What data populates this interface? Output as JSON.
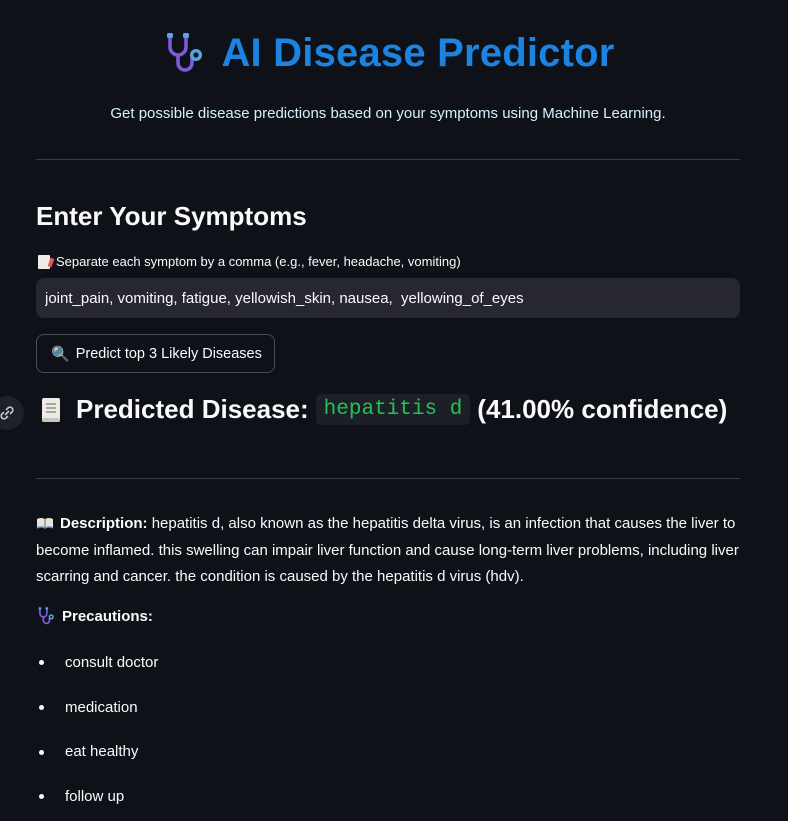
{
  "header": {
    "title": "AI Disease Predictor",
    "subtitle": "Get possible disease predictions based on your symptoms using Machine Learning.",
    "title_color": "#1c83e1",
    "title_icon": "stethoscope-icon"
  },
  "input_section": {
    "heading": "Enter Your Symptoms",
    "helper_icon": "memo-icon",
    "helper_text": "Separate each symptom by a comma (e.g., fever, headache, vomiting)",
    "symptoms_value": "joint_pain, vomiting, fatigue, yellowish_skin, nausea,  yellowing_of_eyes",
    "predict_button_icon": "magnifier-icon",
    "predict_button_label": "Predict top 3 Likely Diseases"
  },
  "result": {
    "icon": "scroll-icon",
    "label": "Predicted Disease:",
    "disease": "hepatitis d",
    "confidence": "(41.00% confidence)",
    "disease_color": "#21c354",
    "anchor_icon": "link-icon"
  },
  "details": {
    "description_icon": "book-icon",
    "description_label": "Description:",
    "description_text": "hepatitis d, also known as the hepatitis delta virus, is an infection that causes the liver to become inflamed. this swelling can impair liver function and cause long-term liver problems, including liver scarring and cancer. the condition is caused by the hepatitis d virus (hdv).",
    "precautions_icon": "stethoscope-icon",
    "precautions_label": "Precautions:",
    "precautions": [
      "consult doctor",
      "medication",
      "eat healthy",
      "follow up"
    ]
  },
  "colors": {
    "background": "#0e1117",
    "input_background": "#262730",
    "text": "#fafafa"
  }
}
